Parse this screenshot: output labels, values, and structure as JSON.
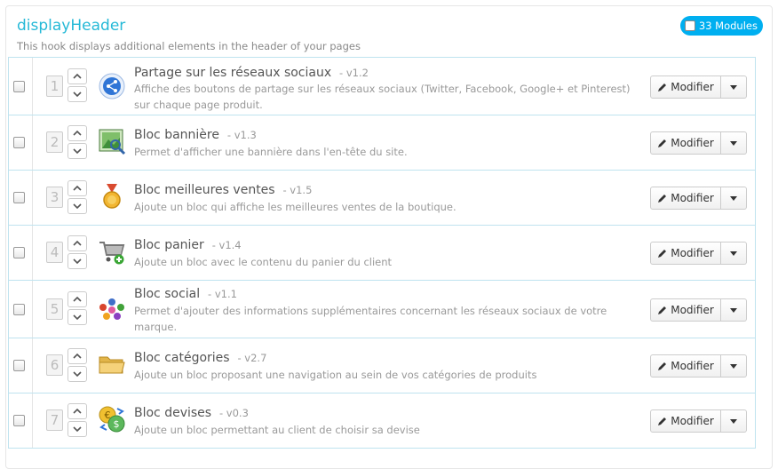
{
  "hook": {
    "title": "displayHeader",
    "description": "This hook displays additional elements in the header of your pages",
    "badge_label": "33 Modules"
  },
  "modify_label": "Modifier",
  "modules": [
    {
      "position": "1",
      "name": "Partage sur les réseaux sociaux",
      "version": "- v1.2",
      "description": "Affiche des boutons de partage sur les réseaux sociaux (Twitter, Facebook, Google+ et Pinterest) sur chaque page produit.",
      "icon": "share-icon"
    },
    {
      "position": "2",
      "name": "Bloc bannière",
      "version": "- v1.3",
      "description": "Permet d'afficher une bannière dans l'en-tête du site.",
      "icon": "banner-icon"
    },
    {
      "position": "3",
      "name": "Bloc meilleures ventes",
      "version": "- v1.5",
      "description": "Ajoute un bloc qui affiche les meilleures ventes de la boutique.",
      "icon": "medal-icon"
    },
    {
      "position": "4",
      "name": "Bloc panier",
      "version": "- v1.4",
      "description": "Ajoute un bloc avec le contenu du panier du client",
      "icon": "cart-icon"
    },
    {
      "position": "5",
      "name": "Bloc social",
      "version": "- v1.1",
      "description": "Permet d'ajouter des informations supplémentaires concernant les réseaux sociaux de votre marque.",
      "icon": "social-icon"
    },
    {
      "position": "6",
      "name": "Bloc catégories",
      "version": "- v2.7",
      "description": "Ajoute un bloc proposant une navigation au sein de vos catégories de produits",
      "icon": "folder-icon"
    },
    {
      "position": "7",
      "name": "Bloc devises",
      "version": "- v0.3",
      "description": "Ajoute un bloc permettant au client de choisir sa devise",
      "icon": "currency-icon"
    }
  ]
}
